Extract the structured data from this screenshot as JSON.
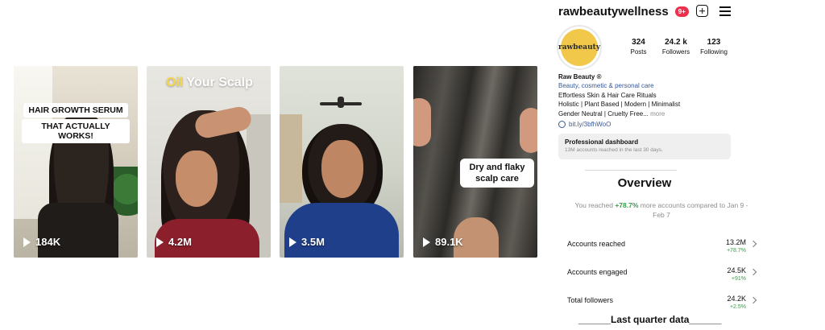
{
  "reels": [
    {
      "caption_lines": [
        "HAIR GROWTH SERUM",
        "THAT ACTUALLY WORKS!"
      ],
      "views": "184K"
    },
    {
      "title_highlight": "Oil",
      "title_rest": " Your Scalp",
      "views": "4.2M"
    },
    {
      "views": "3.5M"
    },
    {
      "caption": "Dry and flaky scalp care",
      "views": "89.1K"
    }
  ],
  "profile": {
    "username": "rawbeautywellness",
    "notification_badge": "9+",
    "avatar_logo_text": "rawbeauty",
    "stats": {
      "posts": {
        "value": "324",
        "label": "Posts"
      },
      "followers": {
        "value": "24.2 k",
        "label": "Followers"
      },
      "following": {
        "value": "123",
        "label": "Following"
      }
    },
    "bio": {
      "name": "Raw Beauty ®",
      "category": "Beauty, cosmetic & personal care",
      "line1": "Effortless Skin & Hair Care Rituals",
      "line2": "Holistic | Plant Based | Modern | Minimalist",
      "line3": "Gender Neutral | Cruelty Free...",
      "more": " more"
    },
    "link": "bit.ly/3bfhWoO",
    "pro_dashboard": {
      "title": "Professional dashboard",
      "subtitle": "13M accounts reached in the last 30 days."
    }
  },
  "overview": {
    "title": "Overview",
    "reach_prefix": "You reached ",
    "reach_pct": "+78.7%",
    "reach_suffix": " more accounts compared to Jan 9 - Feb 7",
    "metrics": [
      {
        "label": "Accounts reached",
        "value": "13.2M",
        "change": "+78.7%"
      },
      {
        "label": "Accounts engaged",
        "value": "24.5K",
        "change": "+91%"
      },
      {
        "label": "Total followers",
        "value": "24.2K",
        "change": "+2.5%"
      }
    ]
  },
  "footer_note": "______Last quarter data______",
  "colors": {
    "accent_blue": "#385898",
    "positive_green": "#3a9a4a",
    "badge_red": "#ed2e4c",
    "logo_yellow": "#f2c84b"
  }
}
